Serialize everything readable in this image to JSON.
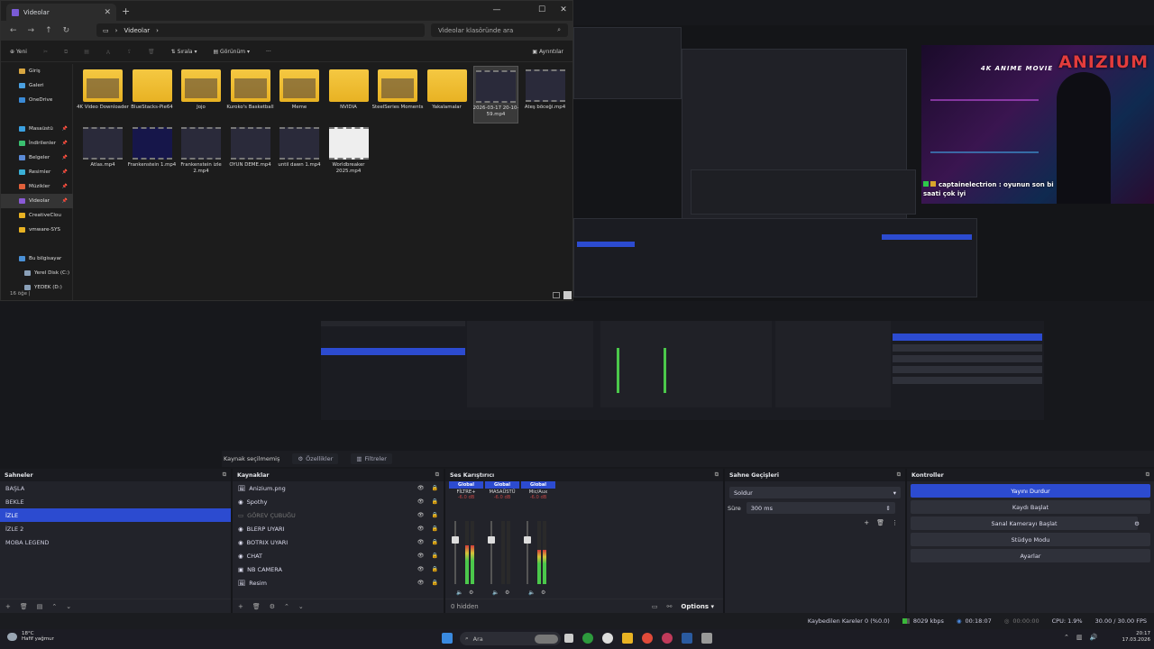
{
  "explorer": {
    "tab_title": "Videolar",
    "path": "Videolar",
    "search_placeholder": "Videolar klasöründe ara",
    "toolbar": {
      "new": "Yeni",
      "sort": "Sırala",
      "view": "Görünüm",
      "more": "···",
      "details": "Ayrıntılar"
    },
    "nav_items": [
      {
        "label": "Giriş",
        "color": "#d8a640"
      },
      {
        "label": "Galeri",
        "color": "#4aa0e0"
      },
      {
        "label": "OneDrive",
        "color": "#3a8ad6"
      },
      {
        "label": "Masaüstü",
        "color": "#3aa0e0"
      },
      {
        "label": "İndirilenler",
        "color": "#3ac070"
      },
      {
        "label": "Belgeler",
        "color": "#5a8ad6"
      },
      {
        "label": "Resimler",
        "color": "#3ab0d6"
      },
      {
        "label": "Müzikler",
        "color": "#e0603a"
      },
      {
        "label": "Videolar",
        "color": "#8a5ad6"
      },
      {
        "label": "CreativeClou",
        "color": "#e8b223"
      },
      {
        "label": "vmware-SYS",
        "color": "#e8b223"
      },
      {
        "label": "Bu bilgisayar",
        "color": "#4a90d6"
      },
      {
        "label": "Yerel Disk (C:)",
        "color": "#8aa0b8"
      },
      {
        "label": "YEDEK (D:)",
        "color": "#8aa0b8"
      }
    ],
    "files": [
      {
        "name": "4K Video Downloader",
        "kind": "folder-img"
      },
      {
        "name": "BlueStacks-Pie64",
        "kind": "folder"
      },
      {
        "name": "Jojo",
        "kind": "folder-img"
      },
      {
        "name": "Kuroko's Basketball",
        "kind": "folder-img"
      },
      {
        "name": "Meme",
        "kind": "folder-img"
      },
      {
        "name": "NVIDIA",
        "kind": "folder"
      },
      {
        "name": "SteelSeries Moments",
        "kind": "folder-img"
      },
      {
        "name": "Yakalamalar",
        "kind": "folder"
      },
      {
        "name": "2026-03-17 20-10-59.mp4",
        "kind": "video"
      },
      {
        "name": "Ateş böceği.mp4",
        "kind": "video"
      },
      {
        "name": "Atlas.mp4",
        "kind": "video"
      },
      {
        "name": "Frankenstein 1.mp4",
        "kind": "video-blue"
      },
      {
        "name": "Frankenstein izle 2.mp4",
        "kind": "video"
      },
      {
        "name": "OYUN DEME.mp4",
        "kind": "video"
      },
      {
        "name": "until dawn 1.mp4",
        "kind": "video"
      },
      {
        "name": "Worldbreaker 2025.mp4",
        "kind": "video-white"
      }
    ],
    "status": "16 öğe  |"
  },
  "overlay": {
    "brand_small": "4K ANIME MOVIE",
    "brand": "ANIZIUM",
    "chat_user": "captainelectrion",
    "chat_text": ": oyunun son bi saati çok iyi"
  },
  "obs": {
    "no_source": "Kaynak seçilmemiş",
    "properties": "Özellikler",
    "filters": "Filtreler",
    "scenes_title": "Sahneler",
    "scenes": [
      "BAŞLA",
      "BEKLE",
      "İZLE",
      "İZLE 2",
      "MOBA LEGEND"
    ],
    "selected_scene": 2,
    "sources_title": "Kaynaklar",
    "sources": [
      {
        "name": "Anizium.png",
        "icon": "🖼",
        "dim": false
      },
      {
        "name": "Spothy",
        "icon": "◉",
        "dim": false
      },
      {
        "name": "GÖREV ÇUBUĞU",
        "icon": "▭",
        "dim": true
      },
      {
        "name": "BLERP UYARI",
        "icon": "◉",
        "dim": false
      },
      {
        "name": "BOTRIX UYARI",
        "icon": "◉",
        "dim": false
      },
      {
        "name": "CHAT",
        "icon": "◉",
        "dim": false
      },
      {
        "name": "NB CAMERA",
        "icon": "▣",
        "dim": false
      },
      {
        "name": "Resim",
        "icon": "🖼",
        "dim": false
      }
    ],
    "mixer_title": "Ses Karıştırıcı",
    "mixer": [
      {
        "head": "Global",
        "name": "FİLTRE+",
        "db": "-6.0 dB",
        "level": 0.62,
        "fader": 0.72
      },
      {
        "head": "Global",
        "name": "MASAÜSTÜ",
        "db": "-6.0 dB",
        "level": 0.0,
        "fader": 0.72
      },
      {
        "head": "Global",
        "name": "Mic/Aux",
        "db": "-6.0 dB",
        "level": 0.55,
        "fader": 0.72
      }
    ],
    "mixer_hidden": "0 hidden",
    "options": "Options",
    "transitions_title": "Sahne Geçişleri",
    "transition": "Soldur",
    "duration_label": "Süre",
    "duration": "300 ms",
    "controls_title": "Kontroller",
    "controls": [
      "Yayını Durdur",
      "Kaydı Başlat",
      "Sanal Kamerayı Başlat",
      "Stüdyo Modu",
      "Ayarlar"
    ],
    "status": {
      "dropped": "Kaybedilen Kareler 0 (%0.0)",
      "bitrate": "8029 kbps",
      "live": "00:18:07",
      "rec": "00:00:00",
      "cpu": "CPU: 1.9%",
      "fps": "30.00 / 30.00 FPS"
    }
  },
  "taskbar": {
    "temp": "18°C",
    "weather": "Hafif yağmur",
    "search": "Ara",
    "time": "20:17",
    "date": "17.03.2026"
  },
  "colors": {
    "accent": "#2c4bd0",
    "folder": "#f0c038",
    "meter_green": "#4bc84b"
  }
}
